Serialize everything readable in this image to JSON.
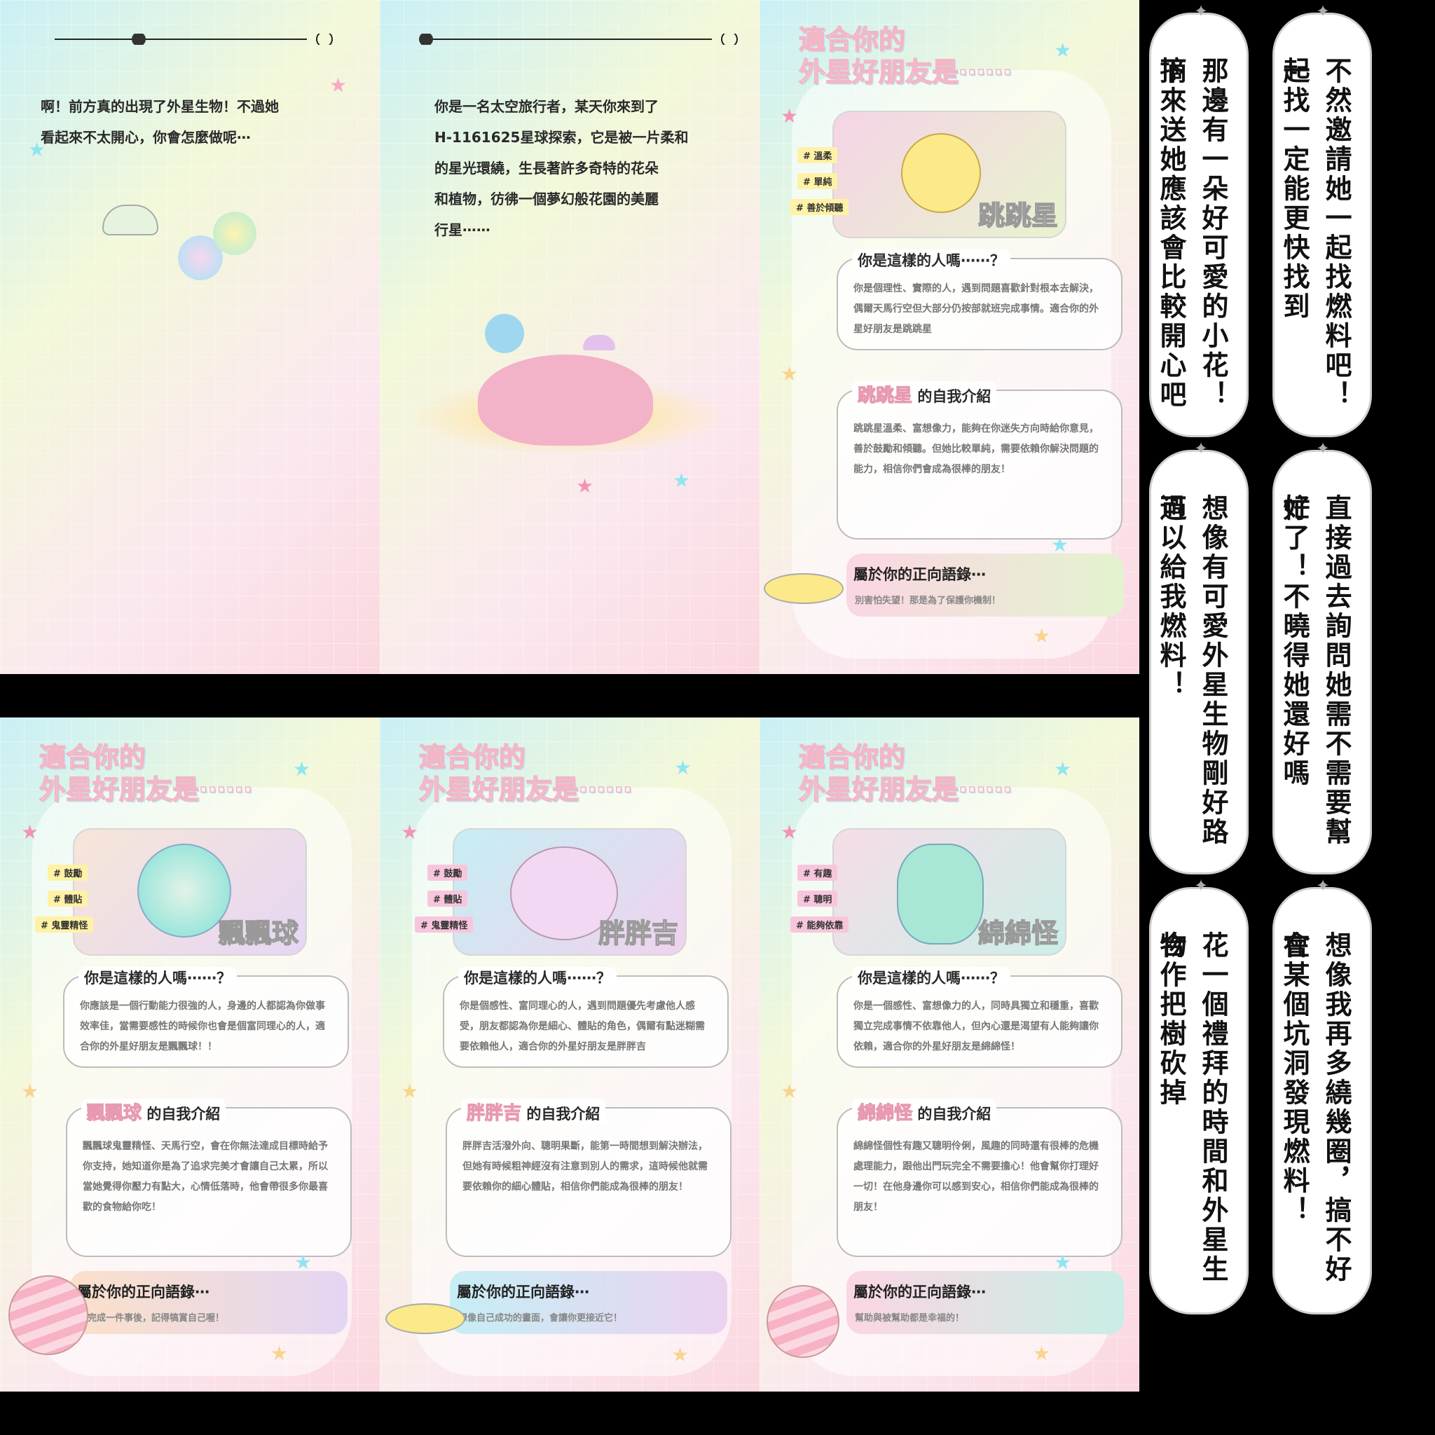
{
  "panels": {
    "p1": {
      "text_line1": "啊！前方真的出現了外星生物！不過她",
      "text_line2": "看起來不太開心，你會怎麼做呢⋯"
    },
    "p2": {
      "text_line1": "你是一名太空旅行者，某天你來到了",
      "text_line2": "H-1161625星球探索，它是被一片柔和",
      "text_line3": "的星光環繞，生長著許多奇特的花朵",
      "text_line4": "和植物，彷彿一個夢幻般花園的美麗",
      "text_line5": "行星⋯⋯"
    }
  },
  "result_cards": [
    {
      "heading1": "適合你的",
      "heading2": "外星好朋友是⋯⋯",
      "name": "跳跳星",
      "tags": [
        "# 溫柔",
        "# 單純",
        "# 善於傾聽"
      ],
      "q_title": "你是這樣的人嗎⋯⋯？",
      "q_text": "你是個理性、實際的人，遇到問題喜歡針對根本去解決，偶爾天馬行空但大部分仍按部就班完成事情。適合你的外星好朋友是跳跳星",
      "intro_suffix": "的自我介紹",
      "intro_text": "跳跳星溫柔、富想像力，能夠在你迷失方向時給你意見，善於鼓勵和傾聽。但她比較單純，需要依賴你解決問題的能力，相信你們會成為很棒的朋友！",
      "quote_title": "屬於你的正向語錄⋯",
      "quote_text": "別害怕失望！那是為了保護你機制！"
    },
    {
      "heading1": "適合你的",
      "heading2": "外星好朋友是⋯⋯",
      "name": "飄飄球",
      "tags": [
        "# 鼓勵",
        "# 體貼",
        "# 鬼靈精怪"
      ],
      "q_title": "你是這樣的人嗎⋯⋯？",
      "q_text": "你應該是一個行動能力很強的人，身邊的人都認為你做事效率佳，當需要感性的時候你也會是個富同理心的人，適合你的外星好朋友是飄飄球！！",
      "intro_suffix": "的自我介紹",
      "intro_text": "飄飄球鬼靈精怪、天馬行空，會在你無法達成目標時給予你支持，她知道你是為了追求完美才會讓自己太累，所以當她覺得你壓力有點大，心情低落時，他會帶很多你最喜歡的食物給你吃！",
      "quote_title": "屬於你的正向語錄⋯",
      "quote_text": "當完成一件事後，記得犒賞自己喔！"
    },
    {
      "heading1": "適合你的",
      "heading2": "外星好朋友是⋯⋯",
      "name": "胖胖吉",
      "tags": [
        "# 鼓勵",
        "# 體貼",
        "# 鬼靈精怪"
      ],
      "q_title": "你是這樣的人嗎⋯⋯？",
      "q_text": "你是個感性、富同理心的人，遇到問題優先考慮他人感受，朋友都認為你是細心、體貼的角色，偶爾有點迷糊需要依賴他人，適合你的外星好朋友是胖胖吉",
      "intro_suffix": "的自我介紹",
      "intro_text": "胖胖吉活潑外向、聰明果斷，能第一時間想到解決辦法，但她有時候粗神經沒有注意到別人的需求，這時候他就需要依賴你的細心體貼，相信你們能成為很棒的朋友！",
      "quote_title": "屬於你的正向語錄⋯",
      "quote_text": "想像自己成功的畫面，會讓你更接近它！"
    },
    {
      "heading1": "適合你的",
      "heading2": "外星好朋友是⋯⋯",
      "name": "綿綿怪",
      "tags": [
        "# 有趣",
        "# 聰明",
        "# 能夠依靠"
      ],
      "q_title": "你是這樣的人嗎⋯⋯？",
      "q_text": "你是一個感性、富想像力的人，同時具獨立和穩重，喜歡獨立完成事情不依靠他人，但內心還是渴望有人能夠讓你依賴，適合你的外星好朋友是綿綿怪！",
      "intro_suffix": "的自我介紹",
      "intro_text": "綿綿怪個性有趣又聰明伶俐，風趣的同時還有很棒的危機處理能力，跟他出門玩完全不需要擔心！他會幫你打理好一切！在他身邊你可以感到安心，相信你們能成為很棒的朋友！",
      "quote_title": "屬於你的正向語錄⋯",
      "quote_text": "幫助與被幫助都是幸福的！"
    }
  ],
  "strips": [
    {
      "col1": "不然邀請她一起找燃料吧！一",
      "col2": "起找一定能更快找到"
    },
    {
      "col1": "那邊有一朵好可愛的小花！摘",
      "col2": "下來送她應該會比較開心吧"
    },
    {
      "col1": "直接過去詢問她需不需要幫忙",
      "col2": "好了！不曉得她還好嗎"
    },
    {
      "col1": "想像有可愛外星生物剛好路過",
      "col2": "可以給我燃料！"
    },
    {
      "col1": "想像我再多繞幾圈，搞不好會",
      "col2": "在某個坑洞發現燃料！"
    },
    {
      "col1": "花一個禮拜的時間和外星生物",
      "col2": "合作把樹砍掉"
    }
  ],
  "colors": {
    "tag_yellow": "#fff2a6",
    "tag_pink": "#f8c6dc",
    "tag_purple": "#e8c6f4",
    "heading_outline": "#f2b6c6"
  }
}
